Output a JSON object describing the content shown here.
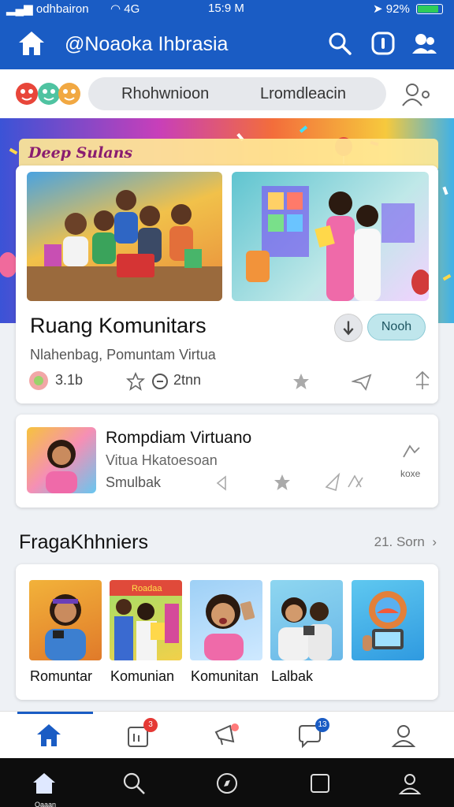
{
  "status_bar": {
    "carrier": "odhbairon",
    "network": "4G",
    "time": "15:9 M",
    "battery": "92%"
  },
  "app_bar": {
    "title": "@Noaoka Ihbrasia"
  },
  "filter_bar": {
    "pill_left": "Rhohwnioon",
    "pill_right": "Lromdleacin"
  },
  "banner": {
    "ribbon_text": "Deep Sulans"
  },
  "featured_card": {
    "title": "Ruang Komunitars",
    "subtitle": "Nlahenbag, Pomuntam Virtua",
    "join_label": "Nooh",
    "likes": "3.1b",
    "time": "2tnn"
  },
  "item_card": {
    "title": "Rompdiam Virtuano",
    "subtitle": "Vitua Hkatoesoan",
    "meta": "Smulbak",
    "tag": "koxe"
  },
  "section": {
    "title": "FragaKhhniers",
    "see_all": "21. Sorn"
  },
  "thumbnails": [
    {
      "label": "Romuntar"
    },
    {
      "label": "Komunian",
      "sign": "Roadaa"
    },
    {
      "label": "Komunitan"
    },
    {
      "label": "Lalbak"
    },
    {
      "label": ""
    }
  ],
  "bottom_nav": {
    "badge_feed": "3",
    "badge_chat": "13"
  },
  "system_nav": {
    "home_label": "Oaaan"
  },
  "colors": {
    "primary": "#1a5cc4",
    "badge_red": "#e53935",
    "badge_blue": "#1a5cc4",
    "pill_bg": "#e6e8ec"
  }
}
